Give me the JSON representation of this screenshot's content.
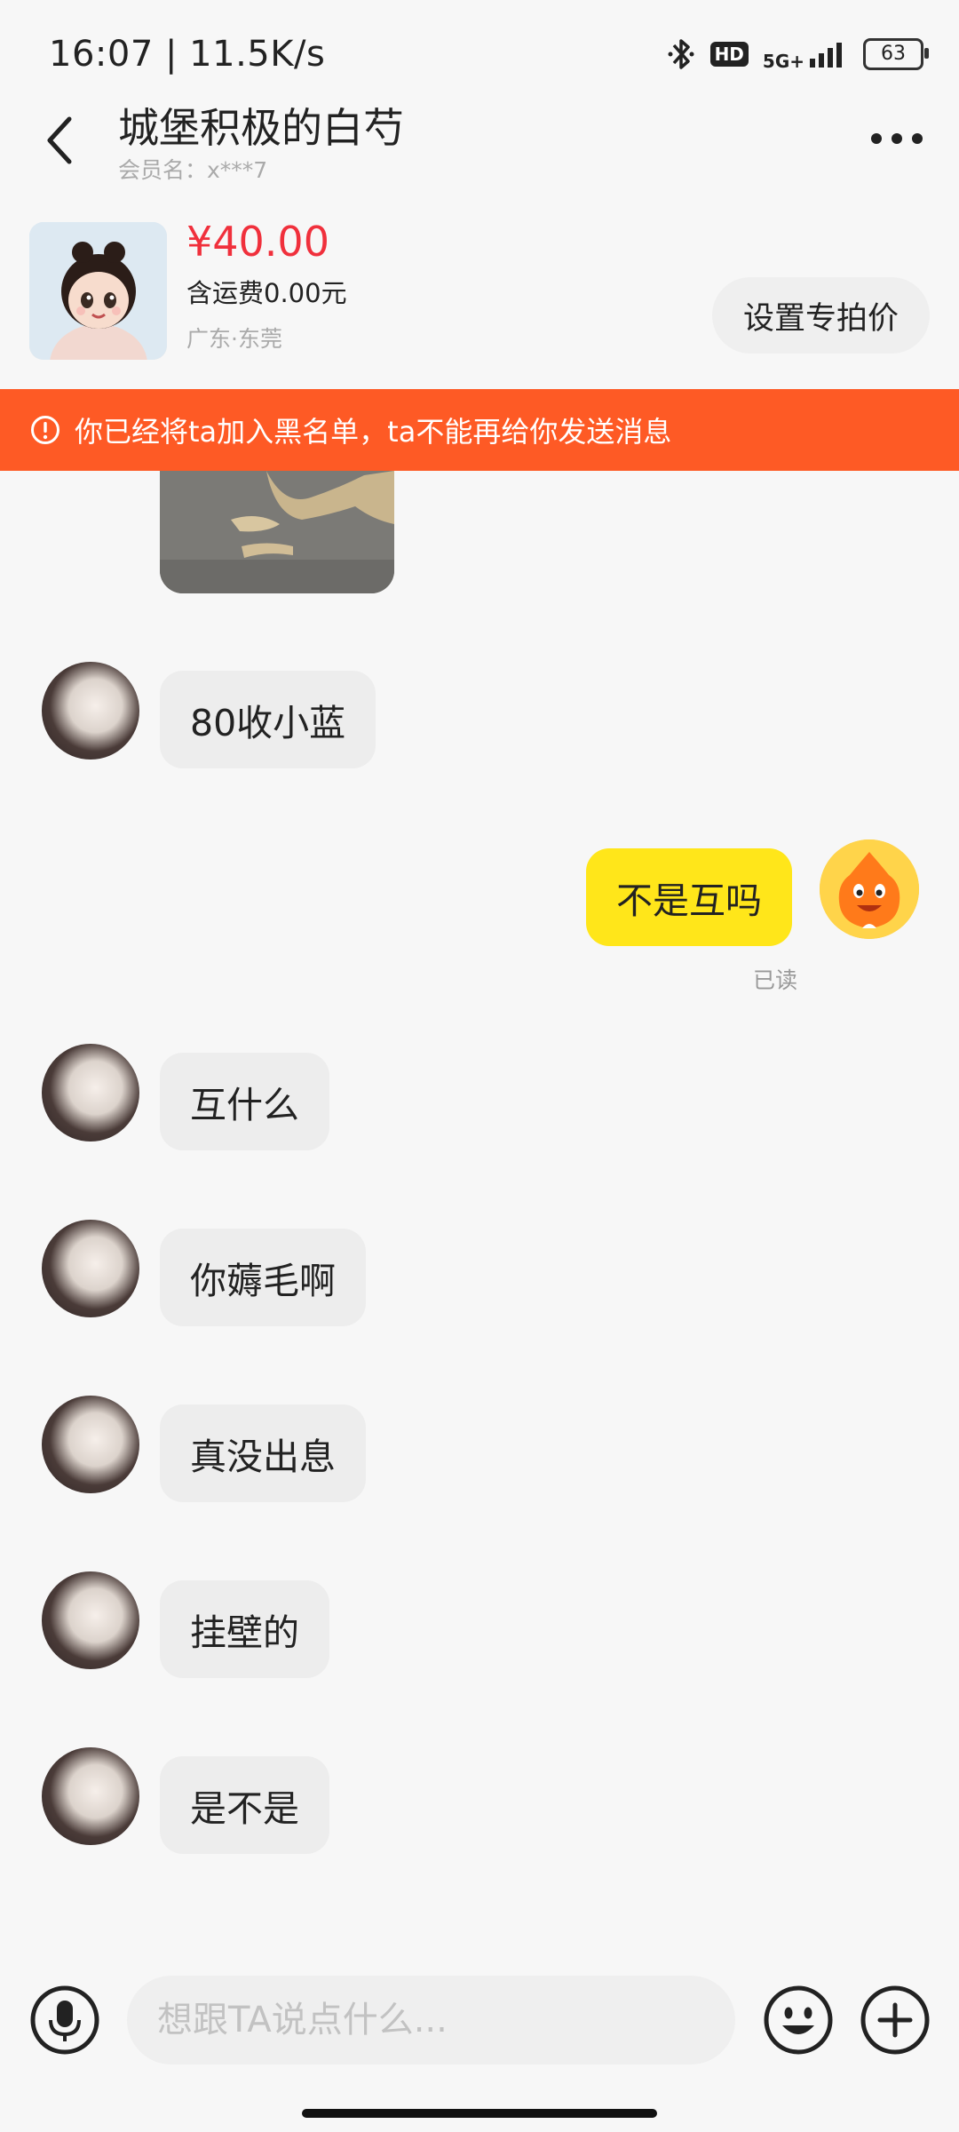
{
  "status_bar": {
    "time_speed": "16:07 | 11.5K/s",
    "bluetooth_icon": "bluetooth-icon",
    "hd_label": "HD",
    "network_label": "5G+",
    "battery": "63"
  },
  "header": {
    "title": "城堡积极的白芍",
    "member_label": "会员名：x***7"
  },
  "product": {
    "price": "¥40.00",
    "shipping": "含运费0.00元",
    "location": "广东·东莞",
    "set_price_label": "设置专拍价"
  },
  "banner": {
    "text": "你已经将ta加入黑名单，ta不能再给你发送消息"
  },
  "messages": [
    {
      "from": "other",
      "text": "80收小蓝"
    },
    {
      "from": "me",
      "text": "不是互吗"
    },
    {
      "from": "other",
      "text": "互什么"
    },
    {
      "from": "other",
      "text": "你薅毛啊"
    },
    {
      "from": "other",
      "text": "真没出息"
    },
    {
      "from": "other",
      "text": "挂壁的"
    },
    {
      "from": "other",
      "text": "是不是"
    }
  ],
  "read_status": "已读",
  "input": {
    "placeholder": "想跟TA说点什么..."
  },
  "colors": {
    "price": "#f0303c",
    "banner": "#fe5a25",
    "my_bubble": "#ffe61a"
  }
}
